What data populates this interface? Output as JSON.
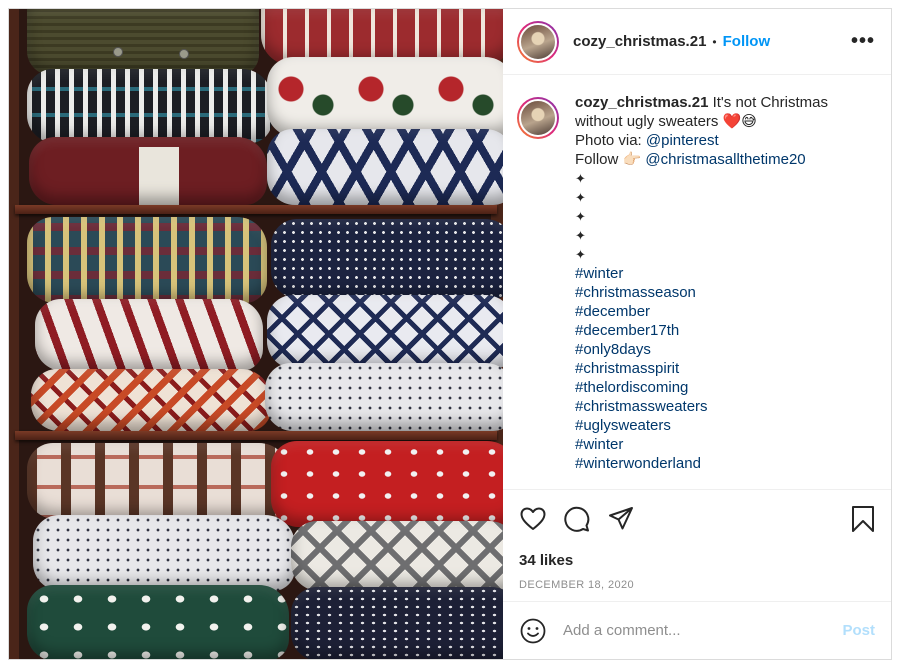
{
  "post": {
    "username": "cozy_christmas.21",
    "header_separator": "•",
    "follow_label": "Follow",
    "more_icon": "more-horizontal-icon",
    "more_glyph": "•••"
  },
  "caption": {
    "username": "cozy_christmas.21",
    "text_line1": " It's not Christmas",
    "text_line2": "without ugly sweaters ",
    "emoji_line2": "❤️😅",
    "photo_via_label": "Photo via: ",
    "photo_via_handle": "@pinterest",
    "follow_label": "Follow ",
    "follow_emoji": "👉🏻",
    "follow_handle": " @christmasallthetime20",
    "sparkles": [
      "✦",
      "✦",
      "✦",
      "✦",
      "✦"
    ],
    "hashtags": [
      "#winter",
      "#christmasseason",
      "#december",
      "#december17th",
      "#only8days",
      "#christmasspirit",
      "#thelordiscoming",
      "#christmassweaters",
      "#uglysweaters",
      "#winter",
      "#winterwonderland"
    ]
  },
  "actions": {
    "like_icon": "heart-icon",
    "comment_icon": "comment-icon",
    "share_icon": "share-icon",
    "save_icon": "bookmark-icon",
    "likes": "34 likes",
    "date": "DECEMBER 18, 2020"
  },
  "comment_box": {
    "emoji_icon": "smiley-icon",
    "placeholder": "Add a comment...",
    "post_label": "Post"
  },
  "colors": {
    "accent": "#0095f6",
    "link": "#00376b",
    "post_disabled": "#b2dffc",
    "muted": "#8e8e8e"
  }
}
